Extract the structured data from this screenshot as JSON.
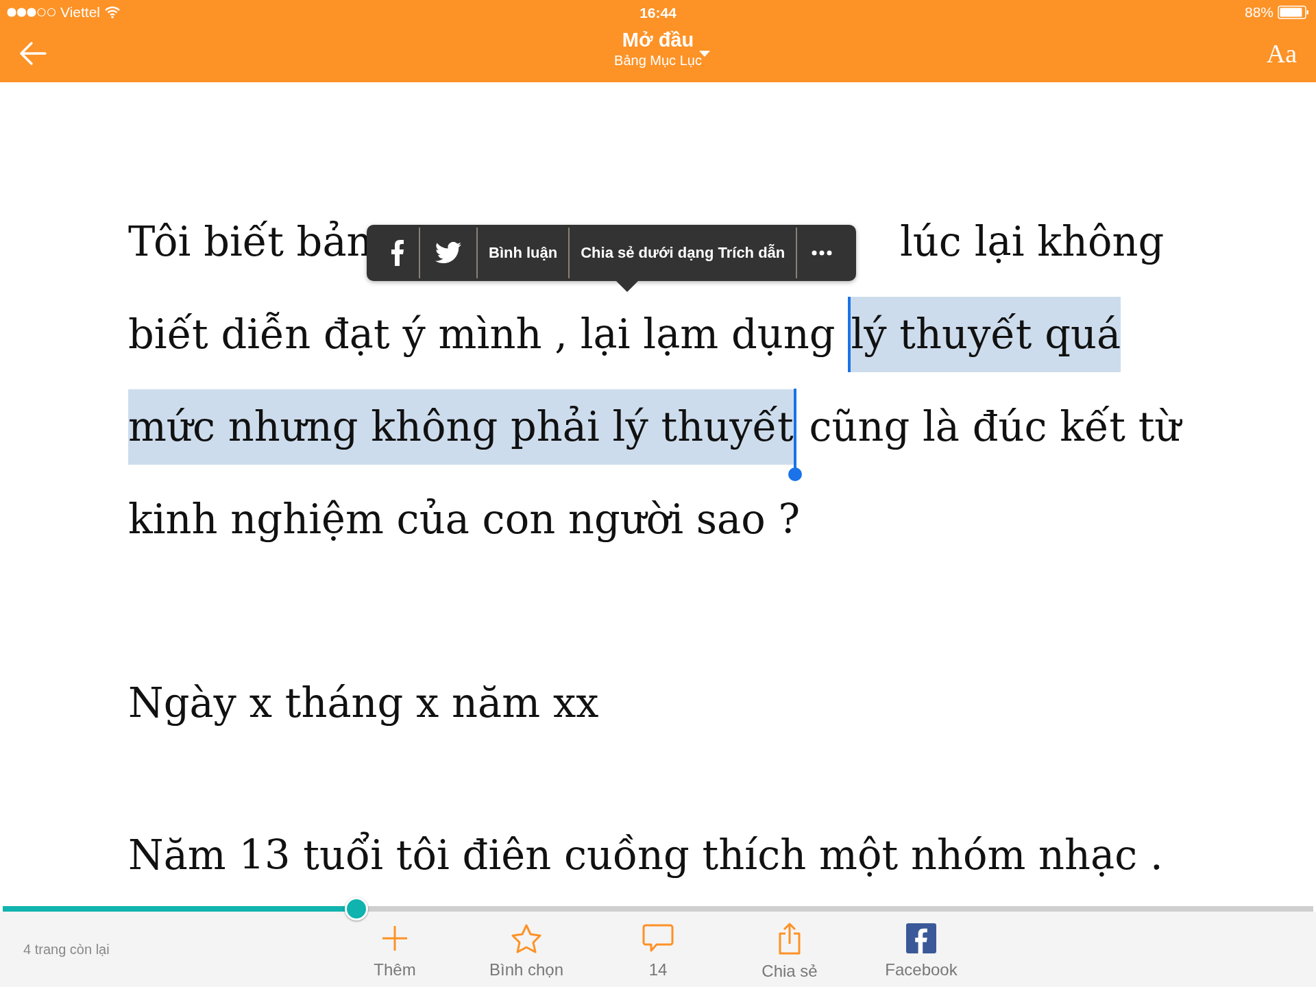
{
  "status_bar": {
    "carrier": "Viettel",
    "time": "16:44",
    "battery": "88%"
  },
  "header": {
    "title": "Mở đầu",
    "subtitle": "Bảng Mục Lục",
    "font_button": "Aa"
  },
  "paragraphs": [
    {
      "lines": [
        {
          "segments": [
            {
              "kind": "text",
              "text": "Tôi biết bản",
              "selected": false
            },
            {
              "kind": "past-menu",
              "text": "lúc lại không",
              "selected": false
            }
          ]
        },
        {
          "segments": [
            {
              "kind": "text",
              "text": "biết diễn đạt ý mình , lại lạm dụng ",
              "selected": false
            },
            {
              "kind": "text",
              "text": "lý thuyết quá",
              "selected": true
            }
          ]
        },
        {
          "segments": [
            {
              "kind": "text",
              "text": "mức nhưng không phải lý thuyết",
              "selected": true
            },
            {
              "kind": "text",
              "text": " cũng là đúc kết từ",
              "selected": false
            }
          ]
        },
        {
          "segments": [
            {
              "kind": "text",
              "text": "kinh nghiệm của con người sao ?",
              "selected": false
            }
          ]
        }
      ]
    },
    {
      "lines": [
        {
          "segments": [
            {
              "kind": "text",
              "text": "Ngày x tháng x năm xx",
              "selected": false
            }
          ]
        }
      ]
    },
    {
      "lines": [
        {
          "segments": [
            {
              "kind": "text",
              "text": "Năm 13 tuổi tôi điên cuồng thích một nhóm nhạc .",
              "selected": false
            }
          ]
        }
      ]
    }
  ],
  "selection_menu": {
    "items": [
      {
        "kind": "facebook"
      },
      {
        "kind": "twitter"
      },
      {
        "kind": "label",
        "text": "Bình luận"
      },
      {
        "kind": "label",
        "text": "Chia sẻ dưới dạng Trích dẫn"
      },
      {
        "kind": "more"
      }
    ]
  },
  "progress": {
    "level": 0.27,
    "pages_left": "4 trang còn lại"
  },
  "toolbar": [
    {
      "kind": "plus",
      "label": "Thêm"
    },
    {
      "kind": "star",
      "label": "Bình chọn"
    },
    {
      "kind": "comment",
      "label": "14"
    },
    {
      "kind": "share",
      "label": "Chia sẻ"
    },
    {
      "kind": "facebook",
      "label": "Facebook"
    }
  ]
}
